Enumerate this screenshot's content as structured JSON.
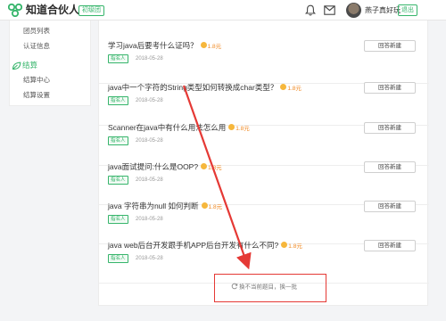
{
  "header": {
    "logo_text": "知道合伙人",
    "level_badge": "初级团",
    "username": "燕子真好玩",
    "logout_label": "退出",
    "brand_color": "#36b56b"
  },
  "sidebar": {
    "items_top": [
      {
        "label": "团员列表"
      },
      {
        "label": "认证信息"
      }
    ],
    "section_label": "结算",
    "items_bottom": [
      {
        "label": "结算中心"
      },
      {
        "label": "结算设置"
      }
    ]
  },
  "questions": [
    {
      "title": "学习java后要考什么证吗？",
      "reward": "1.8元",
      "tag": "指名人",
      "date": "2018-05-28",
      "button": "回答新建"
    },
    {
      "title": "java中一个字符的String类型如何转换成char类型？",
      "reward": "1.8元",
      "tag": "指名人",
      "date": "2018-05-28",
      "button": "回答新建"
    },
    {
      "title": "Scanner在java中有什么用法怎么用",
      "reward": "1.8元",
      "tag": "指名人",
      "date": "2018-05-28",
      "button": "回答新建"
    },
    {
      "title": "java面试提问:什么是OOP?",
      "reward": "1.8元",
      "tag": "指名人",
      "date": "2018-05-28",
      "button": "回答新建"
    },
    {
      "title": "java 字符串为null 如何判断",
      "reward": "1.8元",
      "tag": "指名人",
      "date": "2018-05-28",
      "button": "回答新建"
    },
    {
      "title": "java web后台开发跟手机APP后台开发有什么不同?",
      "reward": "1.8元",
      "tag": "指名人",
      "date": "2018-05-28",
      "button": "回答新建"
    }
  ],
  "refresh": {
    "label": "换不当前题目，换一批"
  },
  "annotation": {
    "color": "#e53935"
  }
}
